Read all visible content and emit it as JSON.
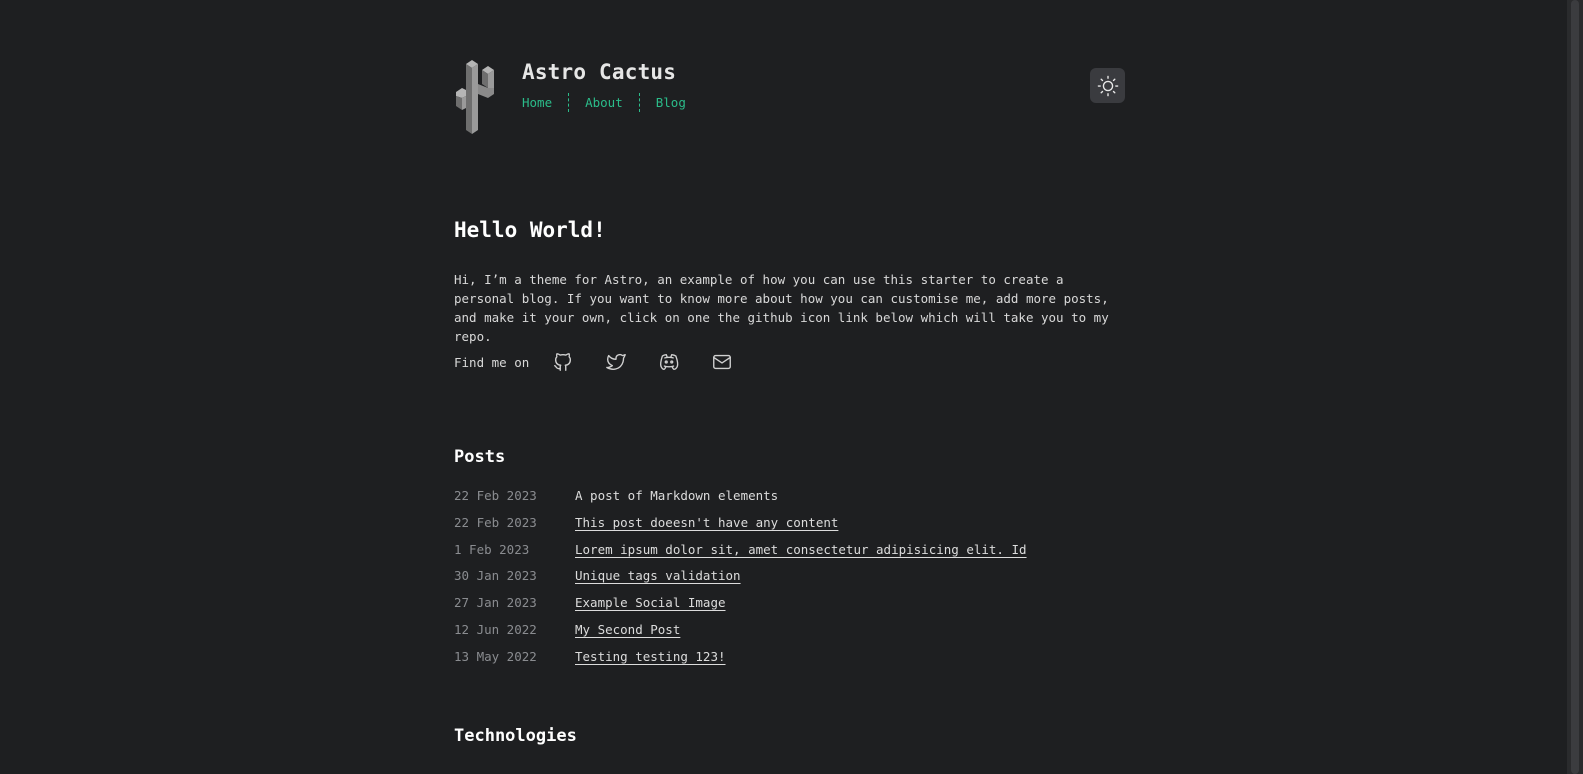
{
  "site": {
    "title": "Astro Cactus",
    "logo_icon": "cactus-logo-icon"
  },
  "nav": {
    "items": [
      {
        "label": "Home"
      },
      {
        "label": "About"
      },
      {
        "label": "Blog"
      }
    ]
  },
  "theme_toggle": {
    "icon": "sun-icon"
  },
  "hero": {
    "title": "Hello World!",
    "text": "Hi, I’m a theme for Astro, an example of how you can use this starter to create a personal blog. If you want to know more about how you can customise me, add more posts, and make it your own, click on one the github icon link below which will take you to my repo."
  },
  "social": {
    "label": "Find me on",
    "links": [
      {
        "icon": "github-icon"
      },
      {
        "icon": "twitter-icon"
      },
      {
        "icon": "discord-icon"
      },
      {
        "icon": "mail-icon"
      }
    ]
  },
  "posts": {
    "title": "Posts",
    "items": [
      {
        "date": "22 Feb 2023",
        "title": "A post of Markdown elements"
      },
      {
        "date": "22 Feb 2023",
        "title": "This post doeesn't have any content"
      },
      {
        "date": "1 Feb 2023",
        "title": "Lorem ipsum dolor sit, amet consectetur adipisicing elit. Id"
      },
      {
        "date": "30 Jan 2023",
        "title": "Unique tags validation"
      },
      {
        "date": "27 Jan 2023",
        "title": "Example Social Image"
      },
      {
        "date": "12 Jun 2022",
        "title": "My Second Post"
      },
      {
        "date": "13 May 2022",
        "title": "Testing testing 123!"
      }
    ]
  },
  "technologies": {
    "title": "Technologies"
  },
  "colors": {
    "background": "#1e1f21",
    "accent": "#2bbc8a",
    "text": "#e0e0e0",
    "muted": "#8a8c90"
  }
}
